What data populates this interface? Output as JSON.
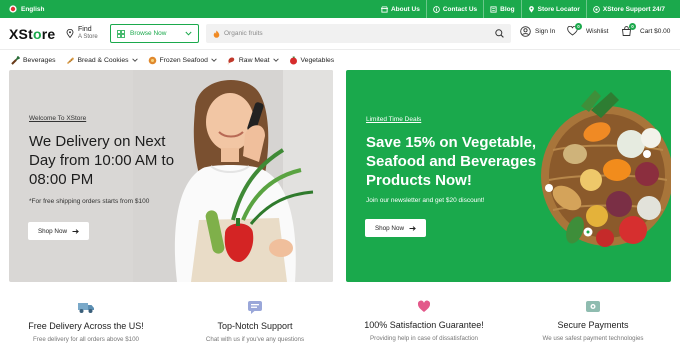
{
  "topbar": {
    "language": "English",
    "links": [
      "About Us",
      "Contact Us",
      "Blog",
      "Store Locator",
      "XStore Support 24/7"
    ]
  },
  "header": {
    "logo_prefix": "XSt",
    "logo_o": "o",
    "logo_suffix": "re",
    "find_label": "Find",
    "find_sub": "A Store",
    "browse_label": "Browse Now",
    "search_placeholder": "Organic fruits",
    "signin_label": "Sign In",
    "wishlist_label": "Wishlist",
    "wishlist_count": "0",
    "cart_label": "Cart $0.00",
    "cart_count": "0"
  },
  "categories": [
    {
      "label": "Beverages",
      "icon": "bottle-icon"
    },
    {
      "label": "Bread & Cookies",
      "icon": "bread-icon"
    },
    {
      "label": "Frozen Seafood",
      "icon": "fish-icon"
    },
    {
      "label": "Raw Meat",
      "icon": "meat-icon"
    },
    {
      "label": "Vegetables",
      "icon": "vegetable-icon"
    }
  ],
  "banner_left": {
    "kicker": "Welcome To XStore",
    "title": "We Delivery on Next Day from 10:00 AM to 08:00 PM",
    "subtitle": "*For free shipping orders starts from $100",
    "button": "Shop Now"
  },
  "banner_right": {
    "kicker": "Limited Time Deals",
    "title": "Save 15% on Vegetable, Seafood and Beverages Products Now!",
    "subtitle": "Join our newsletter and get $20 discount!",
    "button": "Shop Now"
  },
  "features": [
    {
      "title": "Free Delivery Across the US!",
      "desc": "Free delivery for all orders above $100",
      "icon": "truck-icon"
    },
    {
      "title": "Top-Notch Support",
      "desc": "Chat with us if you've any questions",
      "icon": "chat-icon"
    },
    {
      "title": "100% Satisfaction Guarantee!",
      "desc": "Providing help in case of dissatisfaction",
      "icon": "heart-icon"
    },
    {
      "title": "Secure Payments",
      "desc": "We use safest payment technologies",
      "icon": "card-icon"
    }
  ],
  "colors": {
    "brand_green": "#1ba94c",
    "banner_grey": "#d9d7d5"
  }
}
